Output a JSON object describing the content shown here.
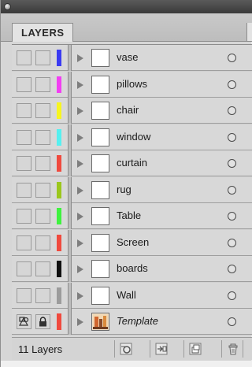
{
  "panel": {
    "tab_label": "LAYERS",
    "layer_count_label": "11 Layers"
  },
  "layers": [
    {
      "name": "vase",
      "color": "#3b3bf2",
      "template": false
    },
    {
      "name": "pillows",
      "color": "#f23ef2",
      "template": false
    },
    {
      "name": "chair",
      "color": "#f7f520",
      "template": false
    },
    {
      "name": "window",
      "color": "#56f0f0",
      "template": false
    },
    {
      "name": "curtain",
      "color": "#f04a3e",
      "template": false
    },
    {
      "name": "rug",
      "color": "#9bc71d",
      "template": false
    },
    {
      "name": "Table",
      "color": "#3ef23e",
      "template": false
    },
    {
      "name": "Screen",
      "color": "#f04a3e",
      "template": false
    },
    {
      "name": "boards",
      "color": "#101010",
      "template": false
    },
    {
      "name": "Wall",
      "color": "#9c9c9c",
      "template": false
    },
    {
      "name": "Template",
      "color": "#f04a3e",
      "template": true
    }
  ],
  "footer_buttons": [
    {
      "icon": "locate-object-icon"
    },
    {
      "icon": "make-clipping-mask-icon"
    },
    {
      "icon": "new-layer-icon"
    },
    {
      "icon": "trash-icon"
    }
  ]
}
